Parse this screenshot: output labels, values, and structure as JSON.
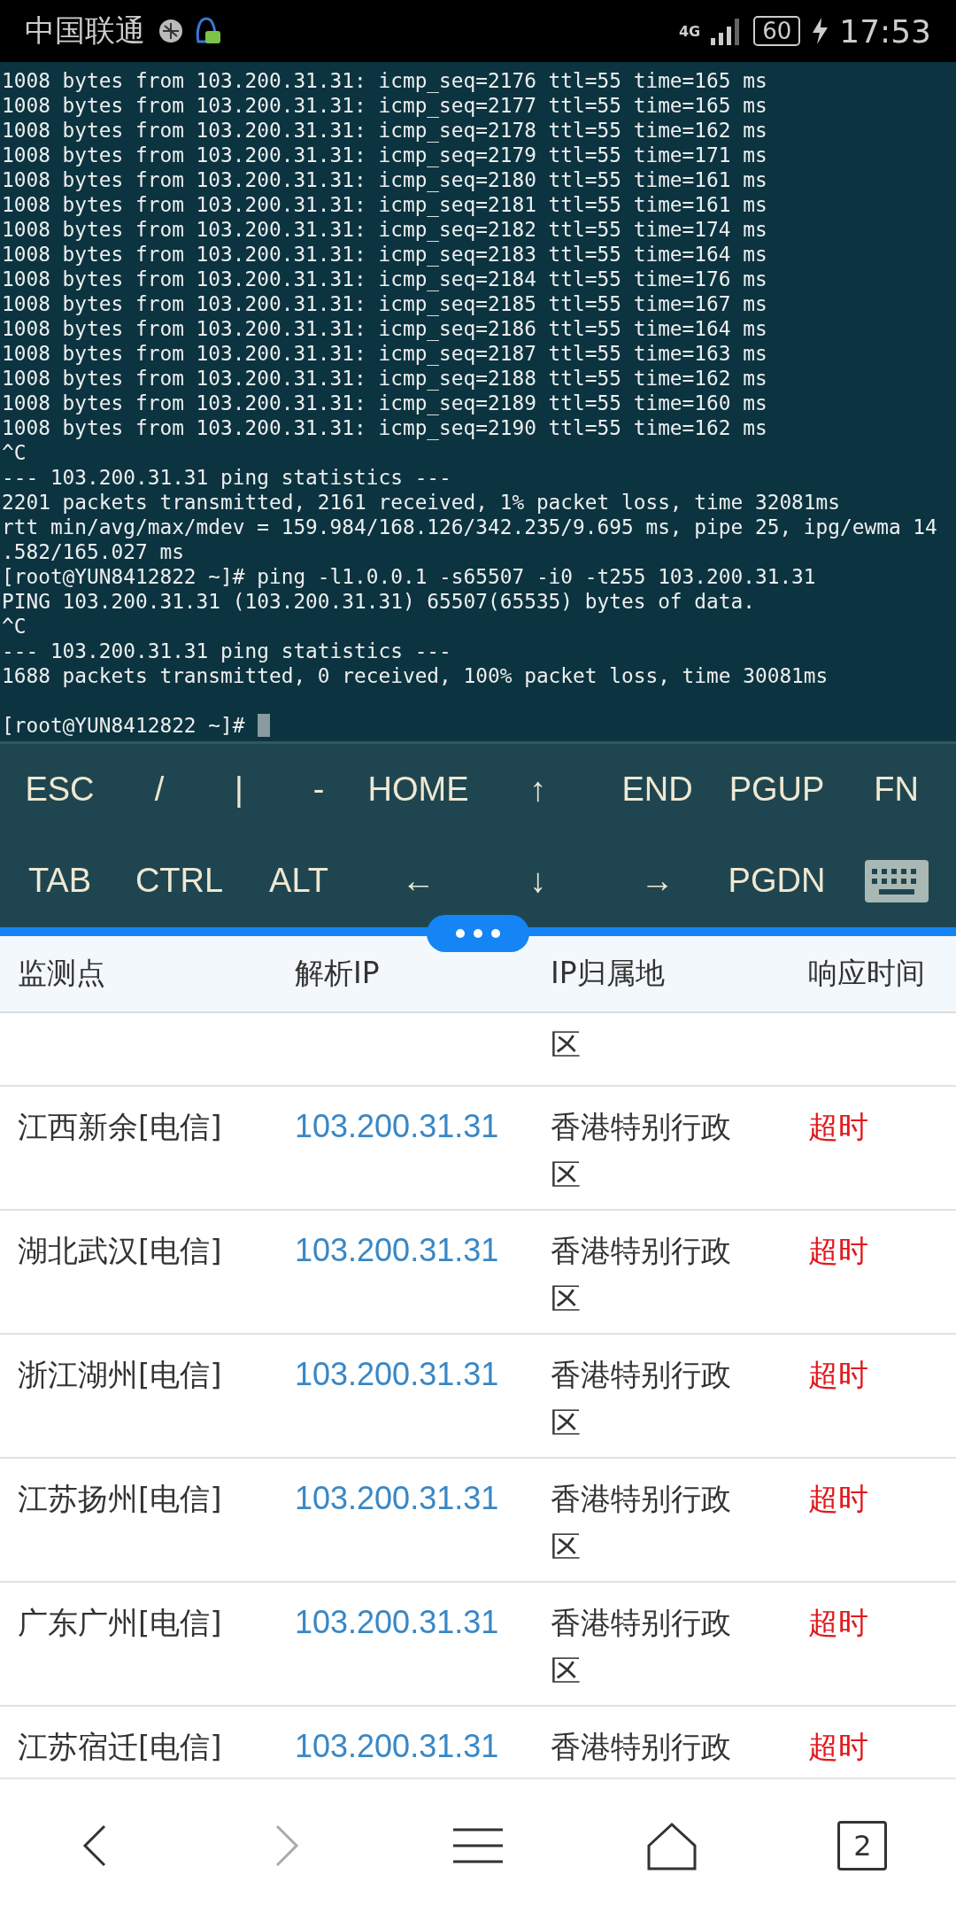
{
  "status_bar": {
    "carrier": "中国联通",
    "network": "4G",
    "battery": "60",
    "time": "17:53"
  },
  "terminal": {
    "lines": [
      "1008 bytes from 103.200.31.31: icmp_seq=2176 ttl=55 time=165 ms",
      "1008 bytes from 103.200.31.31: icmp_seq=2177 ttl=55 time=165 ms",
      "1008 bytes from 103.200.31.31: icmp_seq=2178 ttl=55 time=162 ms",
      "1008 bytes from 103.200.31.31: icmp_seq=2179 ttl=55 time=171 ms",
      "1008 bytes from 103.200.31.31: icmp_seq=2180 ttl=55 time=161 ms",
      "1008 bytes from 103.200.31.31: icmp_seq=2181 ttl=55 time=161 ms",
      "1008 bytes from 103.200.31.31: icmp_seq=2182 ttl=55 time=174 ms",
      "1008 bytes from 103.200.31.31: icmp_seq=2183 ttl=55 time=164 ms",
      "1008 bytes from 103.200.31.31: icmp_seq=2184 ttl=55 time=176 ms",
      "1008 bytes from 103.200.31.31: icmp_seq=2185 ttl=55 time=167 ms",
      "1008 bytes from 103.200.31.31: icmp_seq=2186 ttl=55 time=164 ms",
      "1008 bytes from 103.200.31.31: icmp_seq=2187 ttl=55 time=163 ms",
      "1008 bytes from 103.200.31.31: icmp_seq=2188 ttl=55 time=162 ms",
      "1008 bytes from 103.200.31.31: icmp_seq=2189 ttl=55 time=160 ms",
      "1008 bytes from 103.200.31.31: icmp_seq=2190 ttl=55 time=162 ms",
      "^C",
      "--- 103.200.31.31 ping statistics ---",
      "2201 packets transmitted, 2161 received, 1% packet loss, time 32081ms",
      "rtt min/avg/max/mdev = 159.984/168.126/342.235/9.695 ms, pipe 25, ipg/ewma 14",
      ".582/165.027 ms",
      "[root@YUN8412822 ~]# ping -l1.0.0.1 -s65507 -i0 -t255 103.200.31.31",
      "PING 103.200.31.31 (103.200.31.31) 65507(65535) bytes of data.",
      "^C",
      "--- 103.200.31.31 ping statistics ---",
      "1688 packets transmitted, 0 received, 100% packet loss, time 30081ms"
    ],
    "prompt": "[root@YUN8412822 ~]#"
  },
  "key_rows": [
    [
      "ESC",
      "/",
      "|",
      "-",
      "HOME",
      "↑",
      "END",
      "PGUP",
      "FN"
    ],
    [
      "TAB",
      "CTRL",
      "ALT",
      "←",
      "↓",
      "→",
      "PGDN"
    ]
  ],
  "table": {
    "columns": [
      "监测点",
      "解析IP",
      "IP归属地",
      "响应时间"
    ],
    "partial_row": {
      "column_3": "区"
    },
    "rows": [
      {
        "site": "江西新余[电信]",
        "ip": "103.200.31.31",
        "location": "香港特别行政区",
        "response": "超时"
      },
      {
        "site": "湖北武汉[电信]",
        "ip": "103.200.31.31",
        "location": "香港特别行政区",
        "response": "超时"
      },
      {
        "site": "浙江湖州[电信]",
        "ip": "103.200.31.31",
        "location": "香港特别行政区",
        "response": "超时"
      },
      {
        "site": "江苏扬州[电信]",
        "ip": "103.200.31.31",
        "location": "香港特别行政区",
        "response": "超时"
      },
      {
        "site": "广东广州[电信]",
        "ip": "103.200.31.31",
        "location": "香港特别行政区",
        "response": "超时"
      },
      {
        "site": "江苏宿迁[电信]",
        "ip": "103.200.31.31",
        "location": "香港特别行政",
        "response": "超时"
      }
    ]
  },
  "nav": {
    "forward_disabled": true,
    "tab_count": "2"
  }
}
